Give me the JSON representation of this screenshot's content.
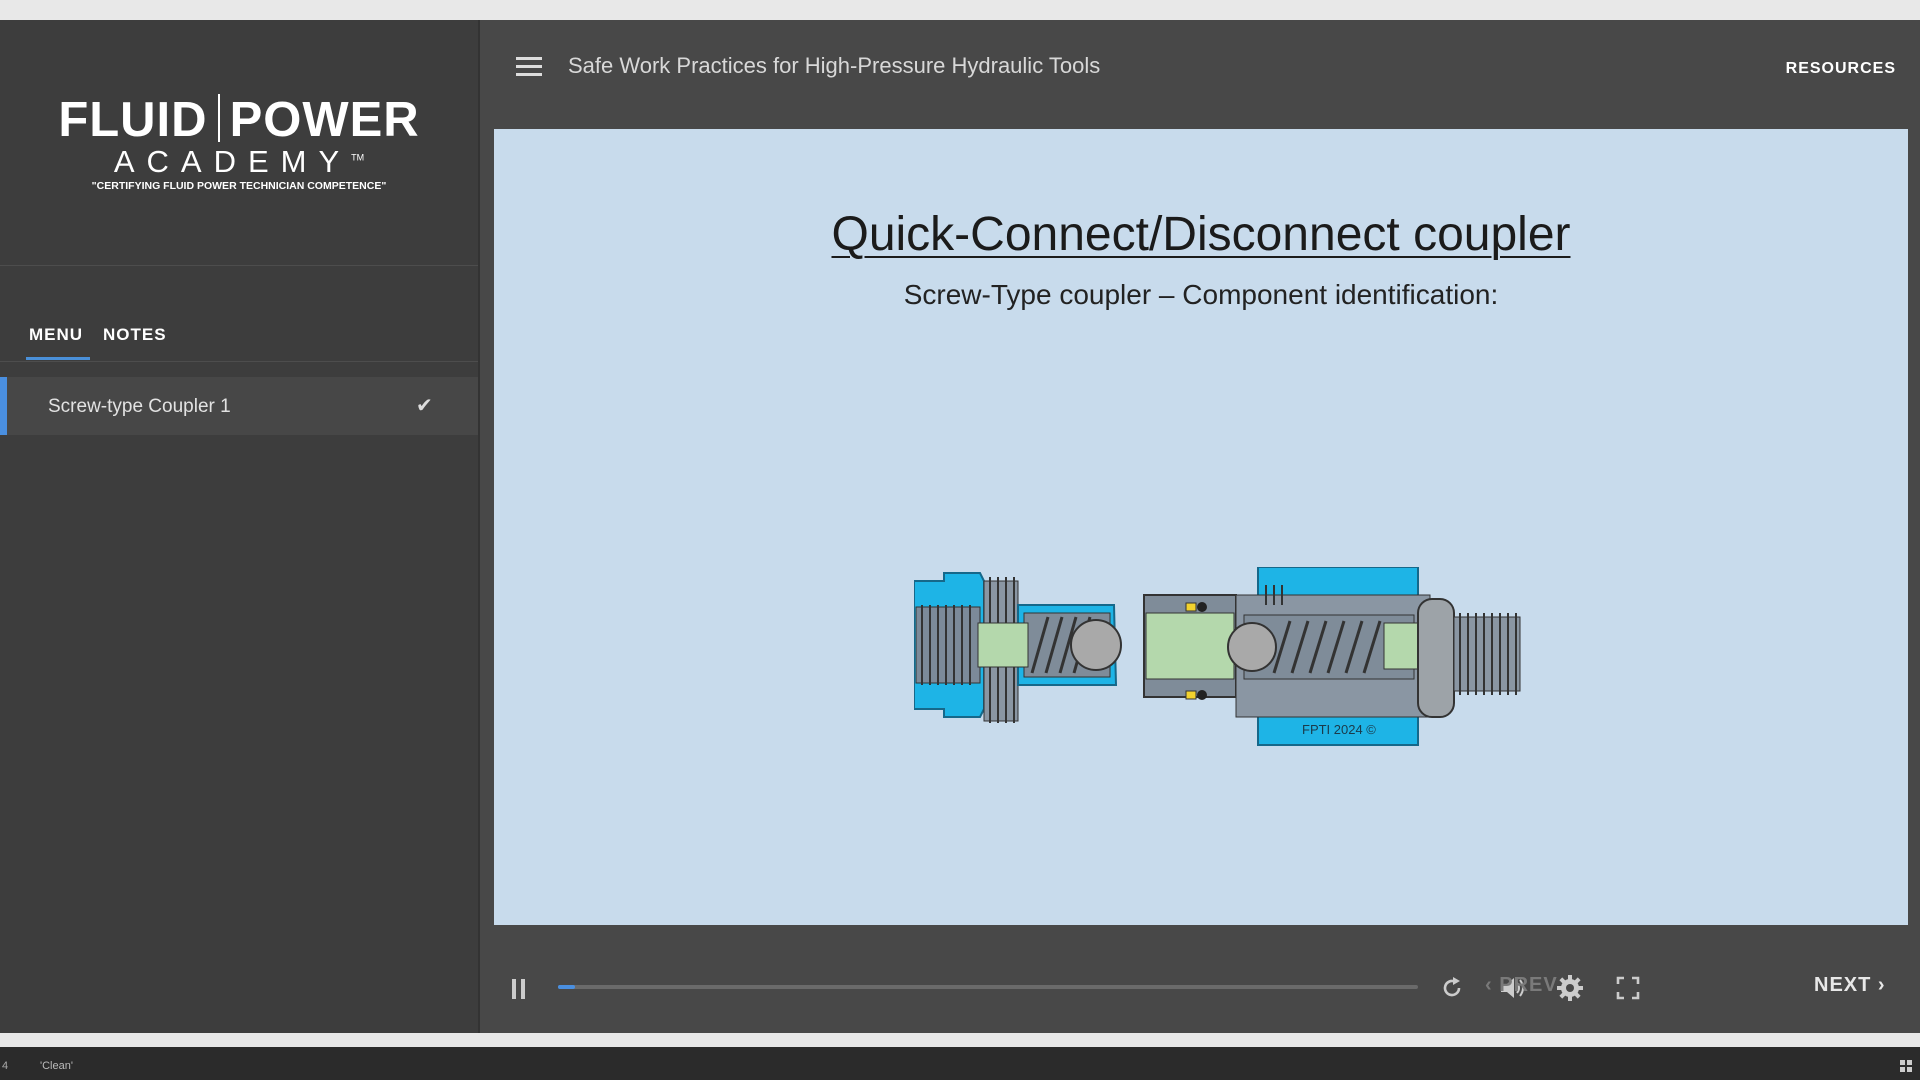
{
  "logo": {
    "line1_left": "FLUID",
    "line1_right": "POWER",
    "line2": "ACADEMY",
    "trademark": "TM",
    "tagline": "\"CERTIFYING FLUID POWER TECHNICIAN COMPETENCE\""
  },
  "sidebar": {
    "tabs": [
      {
        "label": "MENU",
        "active": true
      },
      {
        "label": "NOTES",
        "active": false
      }
    ],
    "items": [
      {
        "label": "Screw-type Coupler 1",
        "completed": true,
        "icon": "check-icon"
      }
    ]
  },
  "header": {
    "menu_icon": "hamburger-icon",
    "course_title": "Safe Work Practices for High-Pressure Hydraulic Tools",
    "resources_label": "RESOURCES"
  },
  "slide": {
    "title": "Quick-Connect/Disconnect coupler",
    "subtitle": "Screw-Type coupler – Component identification:",
    "watermark": "FPTI 2024 ©",
    "background_color": "#c8dbec"
  },
  "player": {
    "play_state": "playing",
    "progress_fraction": 0.02,
    "icons": [
      "pause-icon",
      "replay-icon",
      "volume-icon",
      "settings-icon",
      "fullscreen-icon"
    ],
    "prev_label": "PREV",
    "next_label": "NEXT",
    "prev_enabled": false
  },
  "statusbar": {
    "left_text": "4",
    "label": "'Clean'"
  },
  "colors": {
    "accent": "#4a8fe0",
    "sidebar_bg": "#3d3d3d",
    "main_bg": "#484848",
    "coupler_blue": "#1eb4e6"
  }
}
